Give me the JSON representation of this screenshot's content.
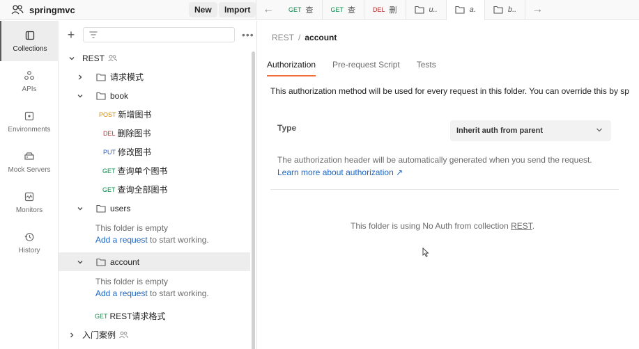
{
  "workspace": {
    "name": "springmvc",
    "new_label": "New",
    "import_label": "Import"
  },
  "tabs": [
    {
      "method": "GET",
      "name": "查"
    },
    {
      "method": "GET",
      "name": "查"
    },
    {
      "method": "DEL",
      "name": "删"
    },
    {
      "type": "folder",
      "name": "u.."
    },
    {
      "type": "folder",
      "name": "a.",
      "active": true
    },
    {
      "type": "folder",
      "name": "b.."
    }
  ],
  "rail": [
    {
      "label": "Collections",
      "icon": "collections-icon",
      "active": true
    },
    {
      "label": "APIs",
      "icon": "apis-icon"
    },
    {
      "label": "Environments",
      "icon": "environments-icon"
    },
    {
      "label": "Mock Servers",
      "icon": "mock-servers-icon"
    },
    {
      "label": "Monitors",
      "icon": "monitors-icon"
    },
    {
      "label": "History",
      "icon": "history-icon"
    }
  ],
  "sidebar": {
    "collection": "REST",
    "folder_qqms": "请求模式",
    "folder_book": "book",
    "book_items": [
      {
        "method": "POST",
        "name": "新增图书"
      },
      {
        "method": "DEL",
        "name": "删除图书"
      },
      {
        "method": "PUT",
        "name": "修改图书"
      },
      {
        "method": "GET",
        "name": "查询单个图书"
      },
      {
        "method": "GET",
        "name": "查询全部图书"
      }
    ],
    "folder_users": "users",
    "empty_text": "This folder is empty",
    "add_request": "Add a request",
    "to_start": " to start working.",
    "folder_account": "account",
    "rest_req": {
      "method": "GET",
      "name": "REST请求格式"
    },
    "intro": "入门案例"
  },
  "main": {
    "breadcrumb_root": "REST",
    "breadcrumb_sep": "/",
    "breadcrumb_current": "account",
    "subtabs": [
      "Authorization",
      "Pre-request Script",
      "Tests"
    ],
    "description": "This authorization method will be used for every request in this folder. You can override this by sp",
    "type_label": "Type",
    "type_value": "Inherit auth from parent",
    "auth_info": "The authorization header will be automatically generated when you send the request.",
    "learn_more": "Learn more about authorization ↗",
    "noauth_prefix": "This folder is using No Auth from collection ",
    "noauth_collection": "REST",
    "noauth_suffix": "."
  },
  "colors": {
    "accent": "#f26b3a",
    "link": "#1c66c2",
    "get": "#0b8a4a",
    "del": "#b52b2b",
    "post": "#ce8c00",
    "put": "#2a60c4"
  }
}
